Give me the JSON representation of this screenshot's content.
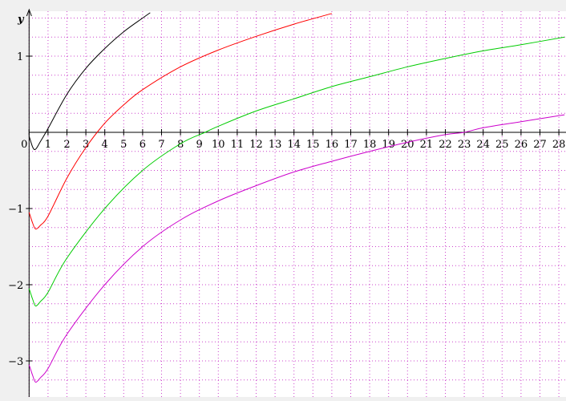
{
  "chart_data": {
    "type": "line",
    "title": "",
    "xlabel": "",
    "ylabel": "y",
    "xlim": [
      -0.1,
      28.3
    ],
    "ylim": [
      -3.5,
      1.6
    ],
    "grid": true,
    "x_ticks": [
      0,
      1,
      2,
      3,
      4,
      5,
      6,
      7,
      8,
      9,
      10,
      11,
      12,
      13,
      14,
      15,
      16,
      17,
      18,
      19,
      20,
      21,
      22,
      23,
      24,
      25,
      26,
      27,
      28
    ],
    "y_ticks": [
      -3,
      -2,
      -1,
      1
    ],
    "y_tick_labels": [
      "−3",
      "−2",
      "−1",
      "1"
    ],
    "series": [
      {
        "color": "#000000",
        "x": [
          0,
          0.2,
          0.35,
          0.6,
          1,
          2,
          3,
          4,
          5,
          6,
          6.4
        ],
        "y": [
          -0.05,
          -0.2,
          -0.22,
          -0.12,
          0.05,
          0.5,
          0.84,
          1.1,
          1.32,
          1.5,
          1.57
        ]
      },
      {
        "color": "#ff0000",
        "x": [
          0,
          0.2,
          0.35,
          0.6,
          1,
          2,
          3,
          4,
          5,
          6,
          8,
          10,
          12,
          14,
          16
        ],
        "y": [
          -1.05,
          -1.2,
          -1.27,
          -1.22,
          -1.1,
          -0.6,
          -0.2,
          0.12,
          0.36,
          0.56,
          0.86,
          1.08,
          1.26,
          1.42,
          1.56
        ]
      },
      {
        "color": "#00cc00",
        "x": [
          0,
          0.2,
          0.35,
          0.6,
          1,
          2,
          4,
          6,
          8,
          9.3,
          10,
          12,
          14,
          16,
          18,
          20,
          22,
          24,
          26,
          28.3
        ],
        "y": [
          -2.05,
          -2.2,
          -2.28,
          -2.22,
          -2.1,
          -1.65,
          -1.0,
          -0.5,
          -0.15,
          0,
          0.08,
          0.28,
          0.44,
          0.6,
          0.73,
          0.86,
          0.97,
          1.07,
          1.15,
          1.25
        ]
      },
      {
        "color": "#cc00cc",
        "x": [
          0,
          0.2,
          0.35,
          0.6,
          1,
          2,
          4,
          6,
          8,
          10,
          12,
          14,
          16,
          18,
          20,
          22,
          23,
          24,
          26,
          28.3
        ],
        "y": [
          -3.05,
          -3.2,
          -3.28,
          -3.22,
          -3.1,
          -2.65,
          -2.0,
          -1.5,
          -1.15,
          -0.9,
          -0.7,
          -0.52,
          -0.38,
          -0.25,
          -0.13,
          -0.03,
          0.0,
          0.06,
          0.14,
          0.23
        ]
      }
    ]
  }
}
